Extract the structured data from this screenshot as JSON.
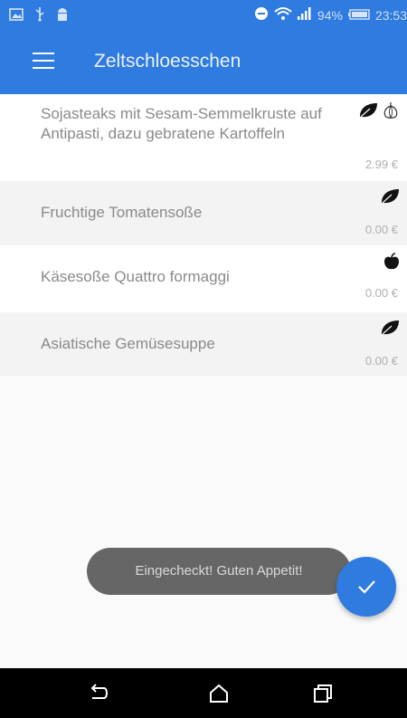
{
  "status_bar": {
    "battery": "94%",
    "time": "23:53",
    "icons": [
      "image-icon",
      "usb-icon",
      "android-icon",
      "do-not-disturb-icon",
      "wifi-icon",
      "signal-icon",
      "battery-icon"
    ]
  },
  "app_bar": {
    "title": "Zeltschloesschen",
    "menu_icon": "hamburger-menu-icon"
  },
  "menu_items": [
    {
      "name": "Sojasteaks mit Sesam-Semmelkruste auf Antipasti, dazu gebratene Kartoffeln",
      "price": "2.99 €",
      "icons": [
        "leaf-icon",
        "garlic-icon"
      ]
    },
    {
      "name": "Fruchtige Tomatensoße",
      "price": "0.00 €",
      "icons": [
        "leaf-icon"
      ]
    },
    {
      "name": "Käsesoße Quattro formaggi",
      "price": "0.00 €",
      "icons": [
        "apple-icon"
      ]
    },
    {
      "name": "Asiatische Gemüsesuppe",
      "price": "0.00 €",
      "icons": [
        "leaf-icon"
      ]
    }
  ],
  "toast": {
    "message": "Eingecheckt! Guten Appetit!"
  },
  "fab": {
    "icon": "checkmark-icon"
  },
  "nav_bar": {
    "icons": [
      "back-icon",
      "home-icon",
      "recents-icon"
    ]
  },
  "colors": {
    "primary": "#2f7be0",
    "toast": "#666666",
    "nav": "#000000"
  }
}
